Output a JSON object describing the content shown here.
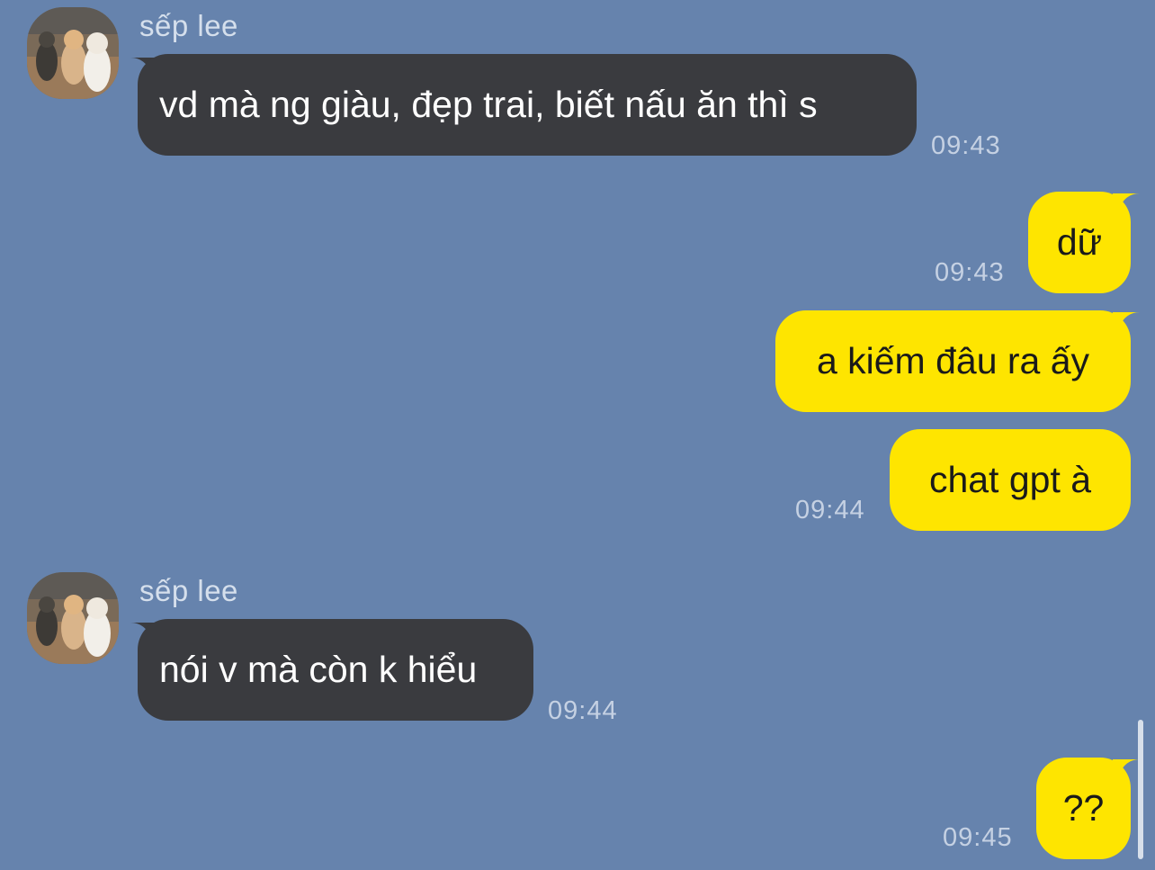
{
  "chat": {
    "colors": {
      "background": "#6683ad",
      "incoming_bubble": "#3a3b3f",
      "outgoing_bubble": "#fee500",
      "timestamp": "#c5d1e3"
    },
    "messages": [
      {
        "direction": "incoming",
        "sender": "sếp lee",
        "avatar": "cats-avatar",
        "text": "vd mà ng giàu, đẹp trai, biết nấu ăn thì s",
        "time": "09:43"
      },
      {
        "direction": "outgoing",
        "text": "dữ",
        "time": "09:43"
      },
      {
        "direction": "outgoing",
        "text": "a kiếm đâu ra ấy",
        "time": ""
      },
      {
        "direction": "outgoing",
        "text": "chat gpt à",
        "time": "09:44"
      },
      {
        "direction": "incoming",
        "sender": "sếp lee",
        "avatar": "cats-avatar",
        "text": "nói v mà còn k hiểu",
        "time": "09:44"
      },
      {
        "direction": "outgoing",
        "text": "??",
        "time": "09:45"
      }
    ]
  }
}
